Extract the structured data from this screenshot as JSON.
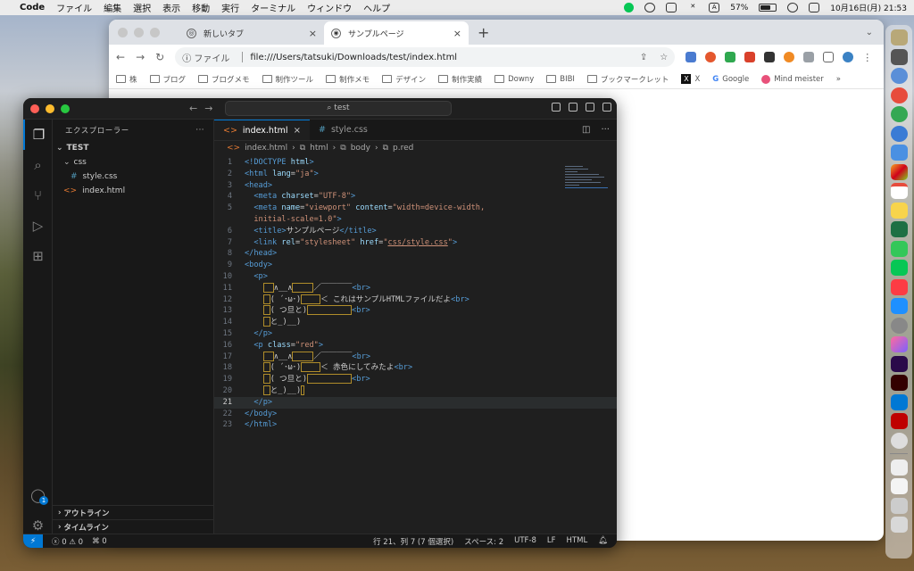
{
  "menubar": {
    "apple": "",
    "app": "Code",
    "items": [
      "ファイル",
      "編集",
      "選択",
      "表示",
      "移動",
      "実行",
      "ターミナル",
      "ウィンドウ",
      "ヘルプ"
    ],
    "battery": "57%",
    "datetime": "10月16日(月)  21:53",
    "input_mode": "A"
  },
  "browser": {
    "tabs": [
      {
        "label": "新しいタブ",
        "close": "×"
      },
      {
        "label": "サンプルページ",
        "close": "×"
      }
    ],
    "new_tab": "+",
    "url_label": "ファイル",
    "url": "file:///Users/tatsuki/Downloads/test/index.html",
    "bookmarks": [
      "株",
      "ブログ",
      "ブログメモ",
      "制作ツール",
      "制作メモ",
      "デザイン",
      "制作実績",
      "Downy",
      "BIBI",
      "ブックマークレット",
      "X",
      "Google",
      "Mind meister"
    ],
    "bookmarks_more": "»"
  },
  "vscode": {
    "search": "⌕ test",
    "explorer_title": "エクスプローラー",
    "explorer_more": "···",
    "tree": {
      "root": "TEST",
      "folder": "css",
      "css_file": "style.css",
      "html_file": "index.html"
    },
    "outline": "アウトライン",
    "timeline": "タイムライン",
    "tabs": [
      {
        "label": "index.html",
        "close": "×"
      },
      {
        "label": "style.css"
      }
    ],
    "breadcrumb": [
      "index.html",
      "html",
      "body",
      "p.red"
    ],
    "account_badge": "1",
    "status": {
      "errors": "0",
      "warnings": "0",
      "ports": "0",
      "position": "行 21、列 7 (7 個選択)",
      "spaces": "スペース: 2",
      "encoding": "UTF-8",
      "eol": "LF",
      "language": "HTML"
    }
  }
}
